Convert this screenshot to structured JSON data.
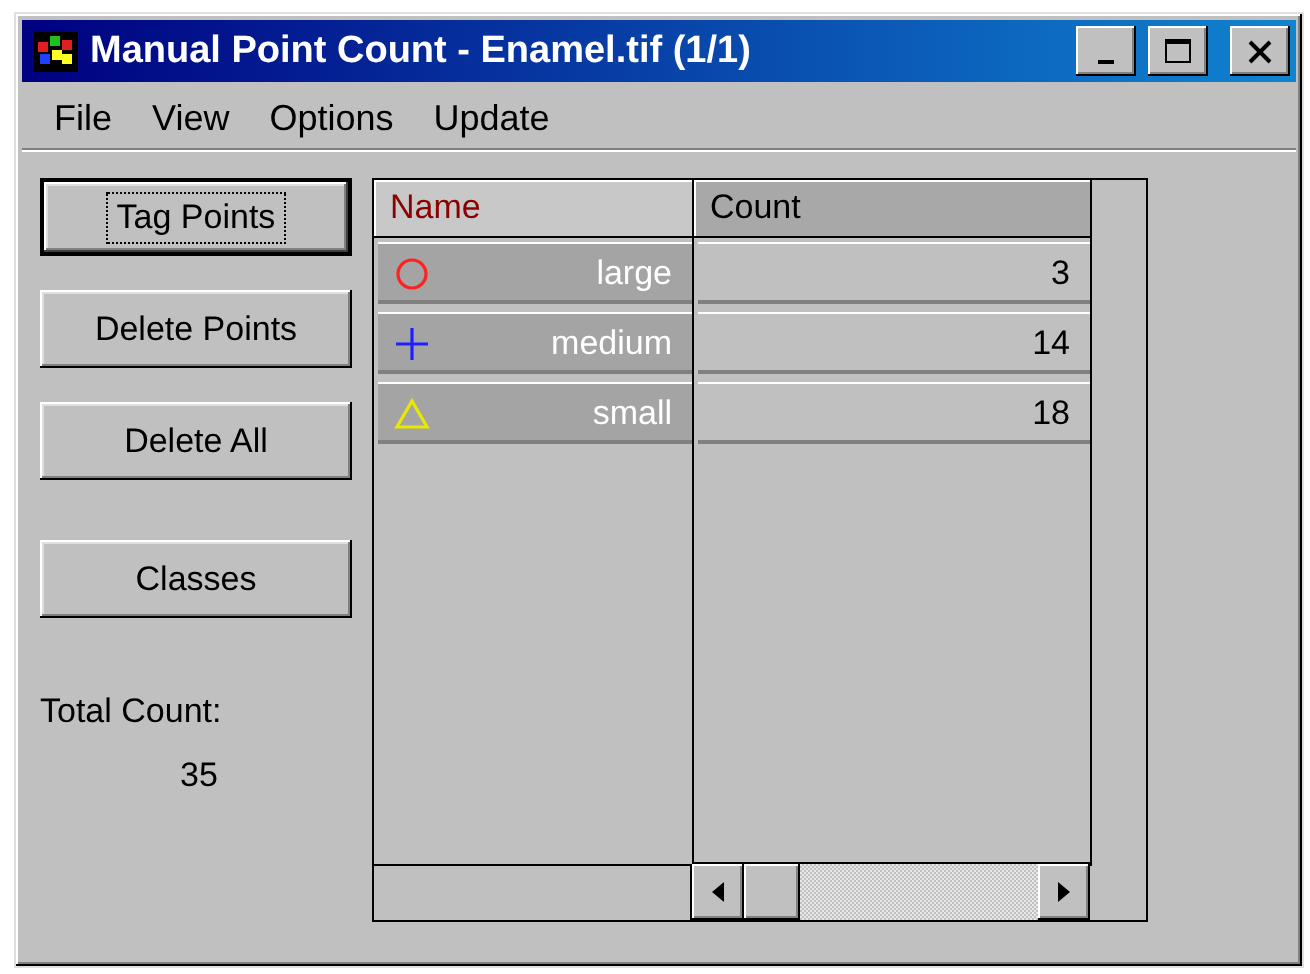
{
  "window": {
    "title": "Manual Point Count - Enamel.tif (1/1)"
  },
  "menu": [
    "File",
    "View",
    "Options",
    "Update"
  ],
  "buttons": [
    {
      "label": "Tag Points",
      "focused": true
    },
    {
      "label": "Delete Points",
      "focused": false
    },
    {
      "label": "Delete All",
      "focused": false
    },
    {
      "label": "Classes",
      "focused": false
    }
  ],
  "total": {
    "label": "Total Count:",
    "value": "35"
  },
  "table": {
    "columns": [
      "Name",
      "Count"
    ],
    "rows": [
      {
        "kind": "circle",
        "color": "#ff2020",
        "name": "large",
        "count": "3"
      },
      {
        "kind": "cross",
        "color": "#2020ff",
        "name": "medium",
        "count": "14"
      },
      {
        "kind": "triangle",
        "color": "#e8e800",
        "name": "small",
        "count": "18"
      }
    ]
  }
}
